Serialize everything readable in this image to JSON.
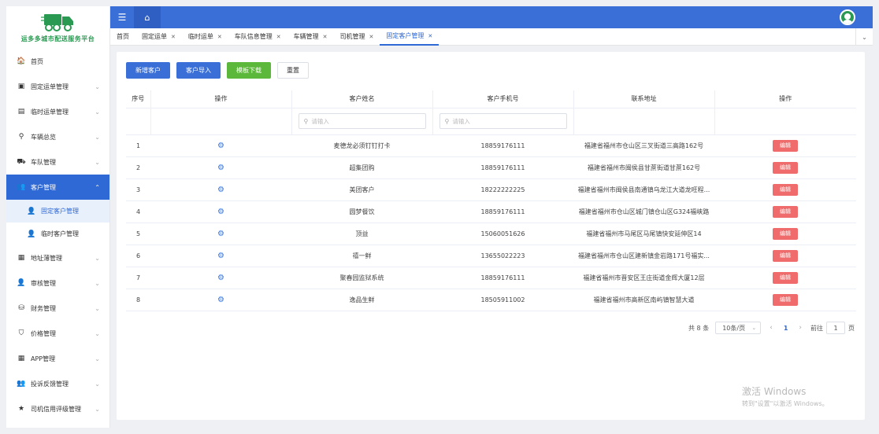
{
  "app": {
    "logo_text": "运多多城市配送服务平台"
  },
  "sidebar": {
    "items": [
      {
        "label": "首页",
        "icon": "home-icon",
        "glyph": "🏠",
        "has_children": false
      },
      {
        "label": "固定运单管理",
        "icon": "clipboard-icon",
        "glyph": "▣",
        "has_children": true
      },
      {
        "label": "临时运单管理",
        "icon": "file-icon",
        "glyph": "▤",
        "has_children": true
      },
      {
        "label": "车辆总览",
        "icon": "location-icon",
        "glyph": "⚲",
        "has_children": true
      },
      {
        "label": "车队管理",
        "icon": "truck-icon",
        "glyph": "⛟",
        "has_children": true
      },
      {
        "label": "客户管理",
        "icon": "users-icon",
        "glyph": "👥",
        "has_children": true,
        "active": true,
        "children": [
          {
            "label": "固定客户管理",
            "icon": "user-icon",
            "glyph": "👤",
            "active": true
          },
          {
            "label": "临时客户管理",
            "icon": "user-plus-icon",
            "glyph": "👤",
            "active": false
          }
        ]
      },
      {
        "label": "地址薄管理",
        "icon": "address-book-icon",
        "glyph": "▦",
        "has_children": true
      },
      {
        "label": "审核管理",
        "icon": "user-check-icon",
        "glyph": "👤",
        "has_children": true
      },
      {
        "label": "财务管理",
        "icon": "money-bag-icon",
        "glyph": "⛁",
        "has_children": true
      },
      {
        "label": "价格管理",
        "icon": "tag-icon",
        "glyph": "⛉",
        "has_children": true
      },
      {
        "label": "APP管理",
        "icon": "grid-icon",
        "glyph": "▦",
        "has_children": true
      },
      {
        "label": "投诉反馈管理",
        "icon": "user-feedback-icon",
        "glyph": "👥",
        "has_children": true
      },
      {
        "label": "司机信用评级管理",
        "icon": "star-icon",
        "glyph": "★",
        "has_children": true
      }
    ]
  },
  "tabs": [
    {
      "label": "首页",
      "closable": false,
      "active": false
    },
    {
      "label": "固定运单",
      "closable": true,
      "active": false
    },
    {
      "label": "临时运单",
      "closable": true,
      "active": false
    },
    {
      "label": "车队信息管理",
      "closable": true,
      "active": false
    },
    {
      "label": "车辆管理",
      "closable": true,
      "active": false
    },
    {
      "label": "司机管理",
      "closable": true,
      "active": false
    },
    {
      "label": "固定客户管理",
      "closable": true,
      "active": true
    }
  ],
  "toolbar": {
    "add_label": "新增客户",
    "import_label": "客户导入",
    "template_label": "模板下载",
    "reset_label": "重置"
  },
  "table": {
    "headers": [
      "序号",
      "操作",
      "客户姓名",
      "客户手机号",
      "联系地址",
      "操作"
    ],
    "filter_placeholder": "请输入",
    "edit_label": "编辑",
    "rows": [
      {
        "index": "1",
        "name": "麦德龙必须钉钉打卡",
        "phone": "18859176111",
        "address": "福建省福州市仓山区三叉街道三高路162号"
      },
      {
        "index": "2",
        "name": "超集团购",
        "phone": "18859176111",
        "address": "福建省福州市闽侯县甘蔗街道甘蔗162号"
      },
      {
        "index": "3",
        "name": "美团客户",
        "phone": "18222222225",
        "address": "福建省福州市闽侯县南通镇乌龙江大道龙旺程..."
      },
      {
        "index": "4",
        "name": "圆梦餐饮",
        "phone": "18859176111",
        "address": "福建省福州市仓山区城门镇仓山区G324福峡路"
      },
      {
        "index": "5",
        "name": "顶益",
        "phone": "15060051626",
        "address": "福建省福州市马尾区马尾镇快安延伸区14"
      },
      {
        "index": "6",
        "name": "禧一鲜",
        "phone": "13655022223",
        "address": "福建省福州市仓山区建新镇金岩路171号福实..."
      },
      {
        "index": "7",
        "name": "聚春园监狱系统",
        "phone": "18859176111",
        "address": "福建省福州市晋安区王庄街道金辉大厦12层"
      },
      {
        "index": "8",
        "name": "逸品生鲜",
        "phone": "18505911002",
        "address": "福建省福州市高新区南屿镇智慧大道"
      }
    ]
  },
  "pagination": {
    "total_text": "共 8 条",
    "page_size": "10条/页",
    "current_page": "1",
    "goto_prefix": "前往",
    "goto_value": "1",
    "goto_suffix": "页"
  },
  "watermark": {
    "line1": "激活 Windows",
    "line2": "转到\"设置\"以激活 Windows。"
  },
  "colors": {
    "primary": "#3a6fd8",
    "success": "#5cb83a",
    "danger": "#f06b6b",
    "brand_green": "#2a9a52"
  }
}
